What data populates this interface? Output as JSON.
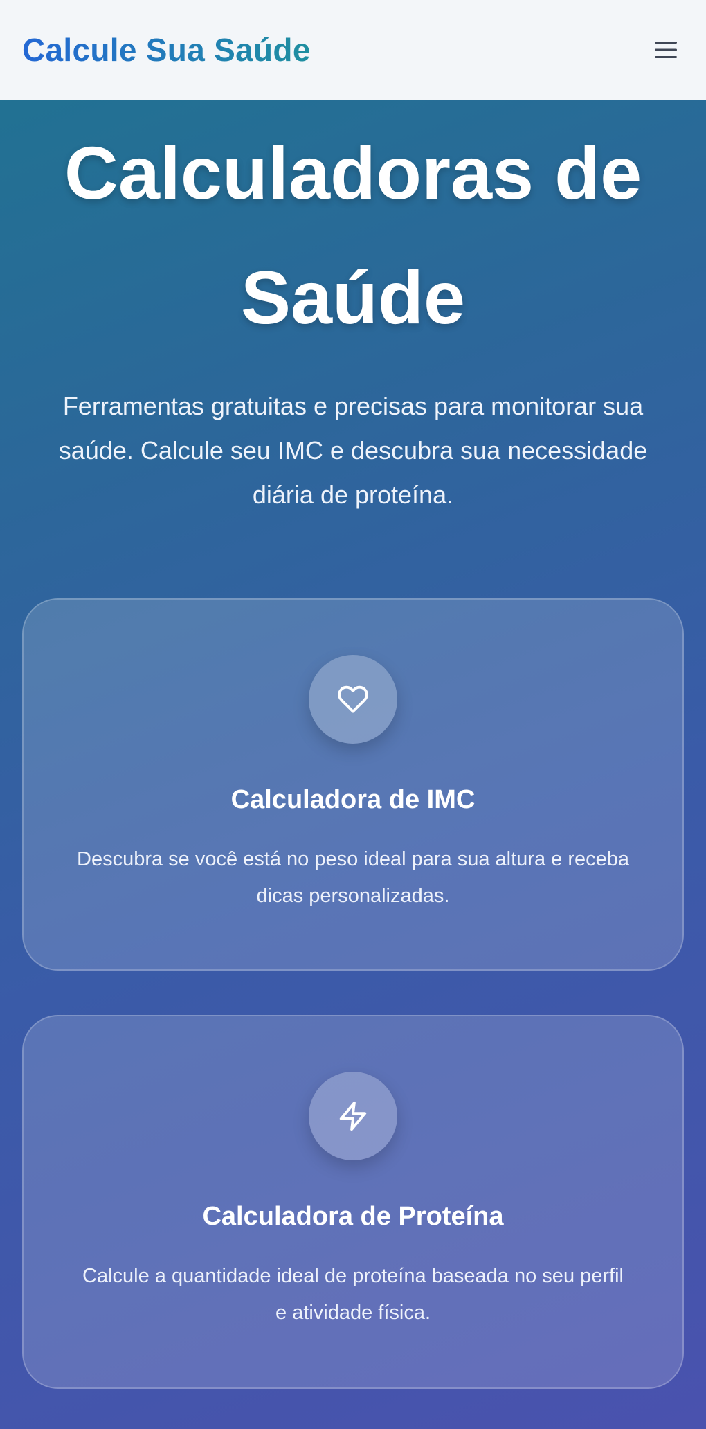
{
  "navbar": {
    "brand": "Calcule Sua Saúde",
    "menu_icon": "hamburger-menu-icon"
  },
  "hero": {
    "title": "Calculadoras de Saúde",
    "subtitle": "Ferramentas gratuitas e precisas para monitorar sua saúde. Calcule seu IMC e descubra sua necessidade diária de proteína."
  },
  "cards": [
    {
      "icon": "heart-icon",
      "title": "Calculadora de IMC",
      "description": "Descubra se você está no peso ideal para sua altura e receba dicas personalizadas."
    },
    {
      "icon": "lightning-icon",
      "title": "Calculadora de Proteína",
      "description": "Calcule a quantidade ideal de proteína baseada no seu perfil e atividade física."
    }
  ],
  "colors": {
    "brand_gradient_start": "#2468d4",
    "brand_gradient_end": "#1f8fa0",
    "background_top": "#1f7491",
    "background_bottom": "#4a52ae",
    "navbar_bg": "#f3f6f9"
  }
}
